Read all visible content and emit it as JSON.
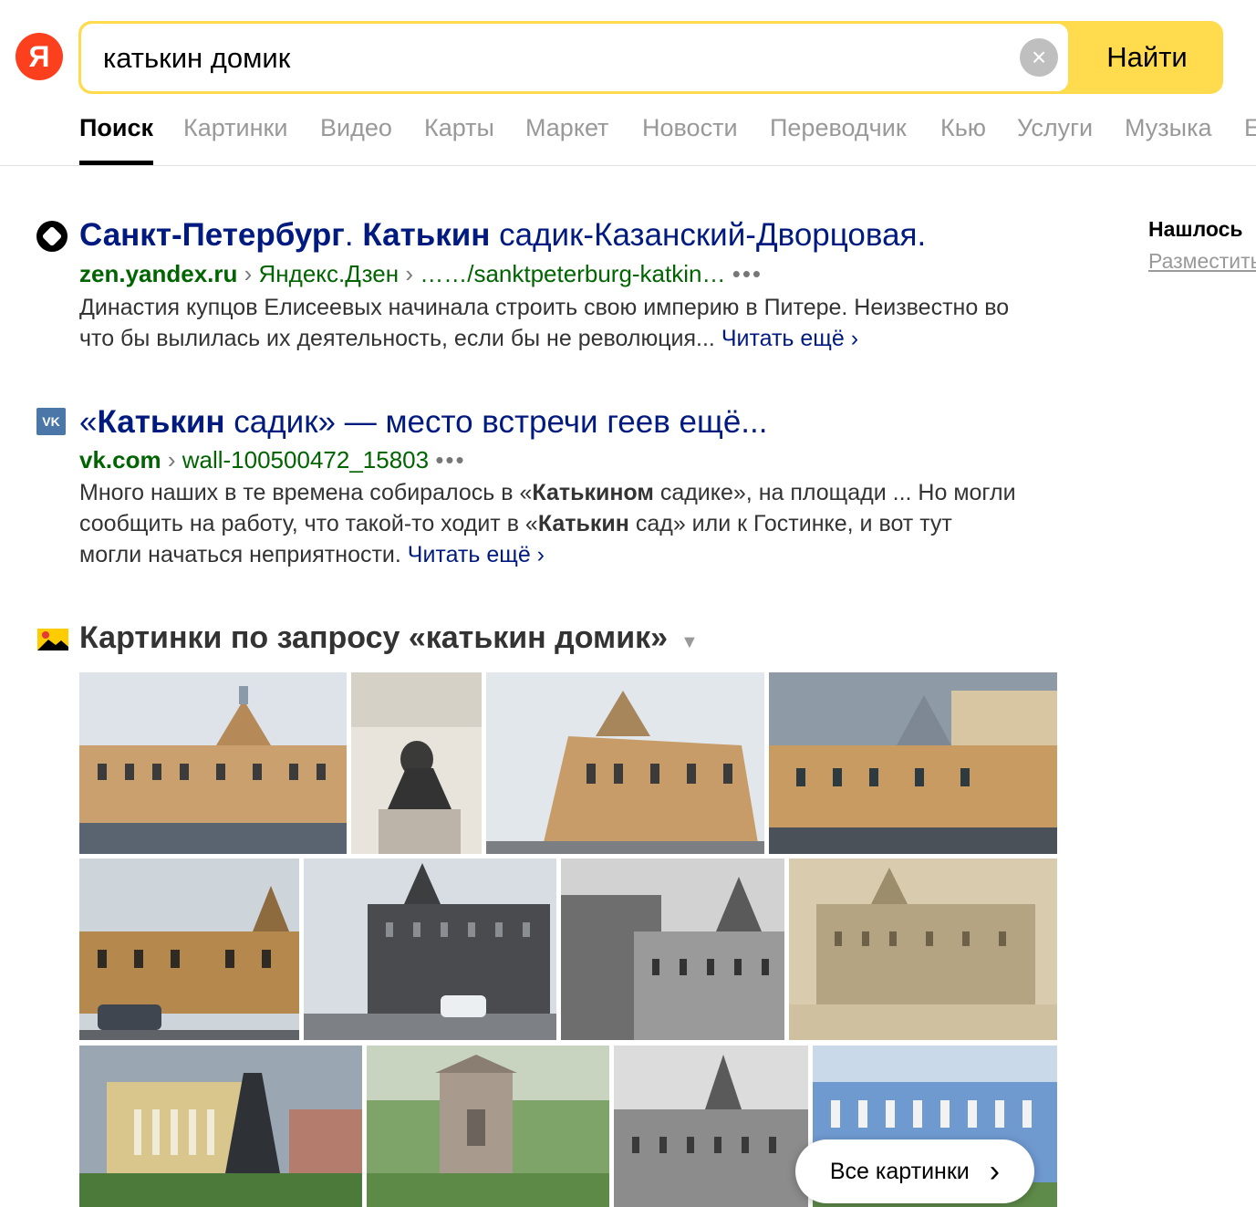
{
  "logo": {
    "letter": "Я"
  },
  "search": {
    "query": "катькин домик",
    "clear_icon": "×",
    "button_label": "Найти"
  },
  "tabs": [
    {
      "label": "Поиск",
      "active": true
    },
    {
      "label": "Картинки"
    },
    {
      "label": "Видео"
    },
    {
      "label": "Карты"
    },
    {
      "label": "Маркет"
    },
    {
      "label": "Новости"
    },
    {
      "label": "Переводчик"
    },
    {
      "label": "Кью"
    },
    {
      "label": "Услуги"
    },
    {
      "label": "Музыка"
    },
    {
      "label": "Е"
    }
  ],
  "sidebar": {
    "found": "Нашлось",
    "place": "Разместить"
  },
  "results": [
    {
      "icon": "zen-icon",
      "title_bold1": "Санкт-Петербург",
      "title_sep": ". ",
      "title_bold2": "Катькин",
      "title_rest": " садик-Казанский-Дворцовая.",
      "host": "zen.yandex.ru",
      "path1": "Яндекс.Дзен",
      "path2": "……/sanktpeterburg-katkin…",
      "dots": "•••",
      "snippet_line1": "Династия купцов Елисеевых начинала строить свою империю в Питере. Неизвестно во",
      "snippet_line2": "что бы вылилась их деятельность, если бы не революция... ",
      "more": "Читать ещё ›"
    },
    {
      "icon": "vk-icon",
      "icon_text": "VK",
      "title_pre": "«",
      "title_bold": "Катькин",
      "title_rest": " садик» — место встречи геев ещё...",
      "host": "vk.com",
      "path1": "wall-100500472_15803",
      "dots": "•••",
      "s1a": "Много наших в те времена собиралось в «",
      "s1b": "Катькином",
      "s1c": " садике», на площади ... Но могли",
      "s2a": "сообщить на работу, что такой-то ходит в «",
      "s2b": "Катькин",
      "s2c": " сад» или к Гостинке, и вот тут",
      "s3": "могли начаться неприятности. ",
      "more": "Читать ещё ›"
    }
  ],
  "images": {
    "title": "Картинки по запросу «катькин домик»",
    "caret": "▼",
    "all_label": "Все картинки",
    "all_chevron": "›"
  }
}
